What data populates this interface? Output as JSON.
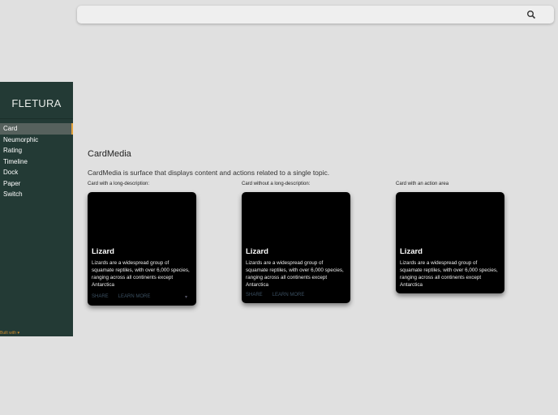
{
  "search": {
    "icon": "search-icon"
  },
  "sidebar": {
    "logo": "FLETURA",
    "items": [
      "Card",
      "Neumorphic",
      "Rating",
      "Timeline",
      "Dock",
      "Paper",
      "Switch"
    ],
    "active": "Card",
    "footer": "Built with ♥"
  },
  "main": {
    "title": "CardMedia",
    "description": "CardMedia is surface that displays content and actions related to a single topic.",
    "cards": [
      {
        "label": "Card with a long-description:",
        "title": "Lizard",
        "text": "Lizards are a widespread group of squamate reptiles, with over 6,000 species, ranging across all continents except Antarctica",
        "share": "SHARE",
        "learn": "LEARN MORE",
        "expand": "▾"
      },
      {
        "label": "Card without a long-description:",
        "title": "Lizard",
        "text": "Lizards are a widespread group of squamate reptiles, with over 6,000 species, ranging across all continents except Antarctica",
        "share": "SHARE",
        "learn": "LEARN MORE"
      },
      {
        "label": "Card with an action area",
        "title": "Lizard",
        "text": "Lizards are a widespread group of squamate reptiles, with over 6,000 species, ranging across all continents except Antarctica"
      }
    ]
  },
  "colors": {
    "sidebar": "#233a35",
    "accent": "#e2a23b"
  }
}
